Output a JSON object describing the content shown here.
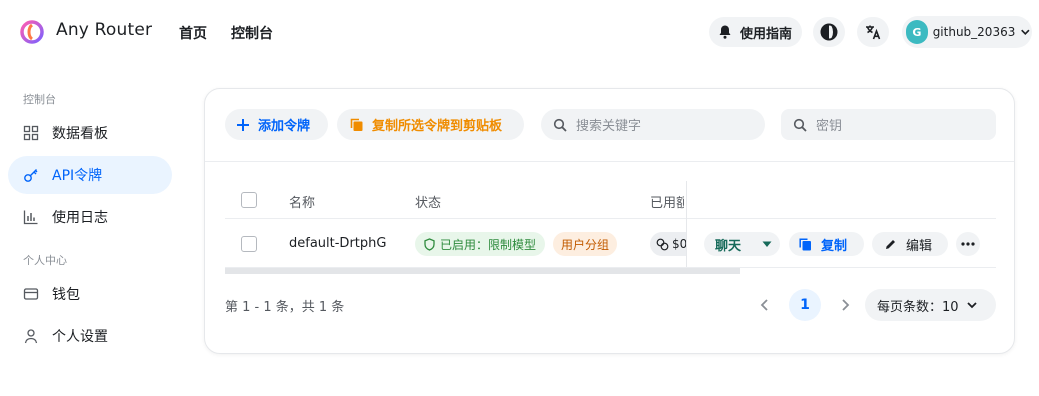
{
  "app": {
    "brand": "Any Router"
  },
  "topnav": {
    "home": "首页",
    "console": "控制台"
  },
  "header": {
    "guide_label": "使用指南",
    "user_initial": "G",
    "username": "github_20363"
  },
  "sidebar": {
    "group_console": "控制台",
    "group_personal": "个人中心",
    "items": [
      {
        "label": "数据看板",
        "icon": "dashboard-grid-icon"
      },
      {
        "label": "API令牌",
        "icon": "key-icon",
        "active": true
      },
      {
        "label": "使用日志",
        "icon": "bar-chart-icon"
      },
      {
        "label": "钱包",
        "icon": "wallet-icon"
      },
      {
        "label": "个人设置",
        "icon": "user-icon"
      }
    ]
  },
  "toolbar": {
    "add_token": "添加令牌",
    "copy_selected": "复制所选令牌到剪贴板",
    "search_placeholder": "搜索关键字",
    "key_placeholder": "密钥"
  },
  "table": {
    "headers": {
      "name": "名称",
      "status": "状态",
      "used_quota": "已用額"
    },
    "rows": [
      {
        "name": "default-DrtphG",
        "status": "已启用：限制模型",
        "group": "用户分组",
        "quota": "$0",
        "actions": {
          "chat": "聊天",
          "copy": "复制",
          "edit": "编辑"
        }
      }
    ]
  },
  "pagination": {
    "summary": "第 1 - 1 条，共 1 条",
    "current_page": "1",
    "per_page_label": "每页条数：10"
  },
  "colors": {
    "accent": "#0064fa",
    "orange": "#f08c00",
    "teal": "#166a5a",
    "status_green": "#2e8b3d",
    "group_orange": "#c25b00"
  }
}
